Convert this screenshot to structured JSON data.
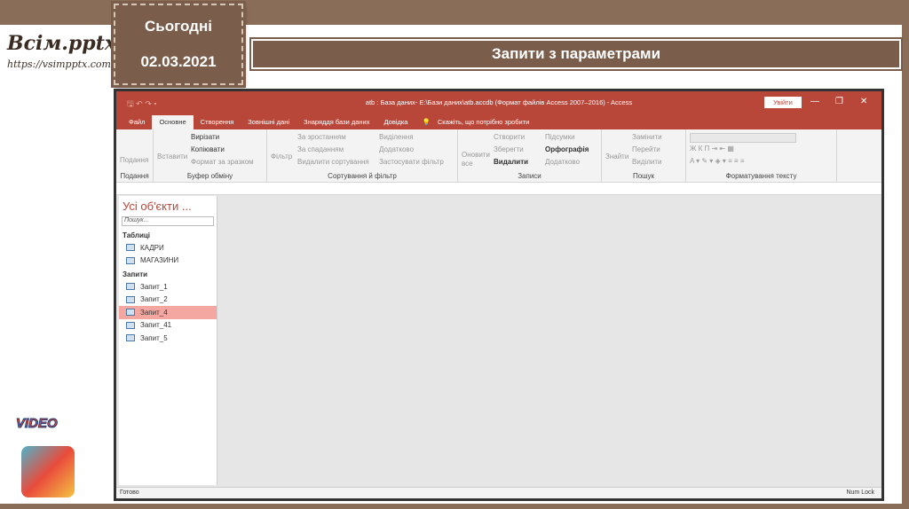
{
  "slide": {
    "date_label": "Сьогодні",
    "date": "02.03.2021",
    "title": "Запити з параметрами",
    "logo": "Всім.pptx",
    "logo_url": "https://vsimpptx.com",
    "video_label": "VIDEO"
  },
  "window": {
    "title": "atb : База даних- E:\\Бази даних\\atb.accdb (Формат файлів Access 2007–2016)  -  Access",
    "signin": "Увійти",
    "tabs": [
      "Файл",
      "Основне",
      "Створення",
      "Зовнішні дані",
      "Знаряддя бази даних",
      "Довідка"
    ],
    "tell_me": "Скажіть, що потрібно зробити",
    "groups": {
      "view": {
        "label": "Подання",
        "items": [
          "Подання"
        ]
      },
      "clipboard": {
        "label": "Буфер обміну",
        "items": [
          "Вставити",
          "Вирізати",
          "Копіювати",
          "Формат за зразком"
        ]
      },
      "sort": {
        "label": "Сортування й фільтр",
        "items": [
          "Фільтр",
          "За зростанням",
          "За спаданням",
          "Видалити сортування",
          "Виділення",
          "Додатково",
          "Застосувати фільтр"
        ]
      },
      "records": {
        "label": "Записи",
        "items": [
          "Оновити все",
          "Створити",
          "Зберегти",
          "Видалити",
          "Підсумки",
          "Орфографія",
          "Додатково"
        ]
      },
      "find": {
        "label": "Пошук",
        "items": [
          "Знайти",
          "Замінити",
          "Перейти",
          "Виділити"
        ]
      },
      "text": {
        "label": "Форматування тексту"
      }
    }
  },
  "nav": {
    "title": "Усі об'єкти ...",
    "search_placeholder": "Пошук...",
    "tables_label": "Таблиці",
    "tables": [
      "КАДРИ",
      "МАГАЗИНИ"
    ],
    "queries_label": "Запити",
    "queries": [
      "Запит_1",
      "Запит_2",
      "Запит_4",
      "Запит_41",
      "Запит_5"
    ],
    "selected": "Запит_4"
  },
  "status": {
    "left": "Готово",
    "right": "Num Lock"
  }
}
